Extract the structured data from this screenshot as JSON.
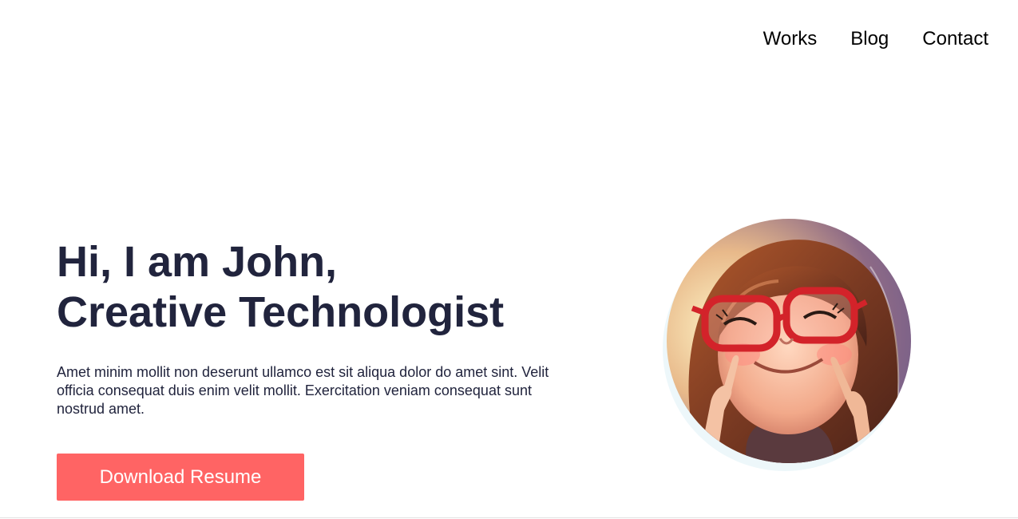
{
  "nav": {
    "items": [
      {
        "label": "Works"
      },
      {
        "label": "Blog"
      },
      {
        "label": "Contact"
      }
    ]
  },
  "hero": {
    "title_line1": "Hi, I am John,",
    "title_line2": "Creative Technologist",
    "description": "Amet minim mollit non deserunt ullamco est sit aliqua dolor do amet sint. Velit officia consequat duis enim velit mollit. Exercitation veniam consequat sunt nostrud amet.",
    "button_label": "Download Resume"
  },
  "colors": {
    "heading": "#21243d",
    "accent": "#ff6464",
    "avatar_shadow": "#edf7fa"
  },
  "avatar": {
    "icon": "avatar-illustration"
  }
}
